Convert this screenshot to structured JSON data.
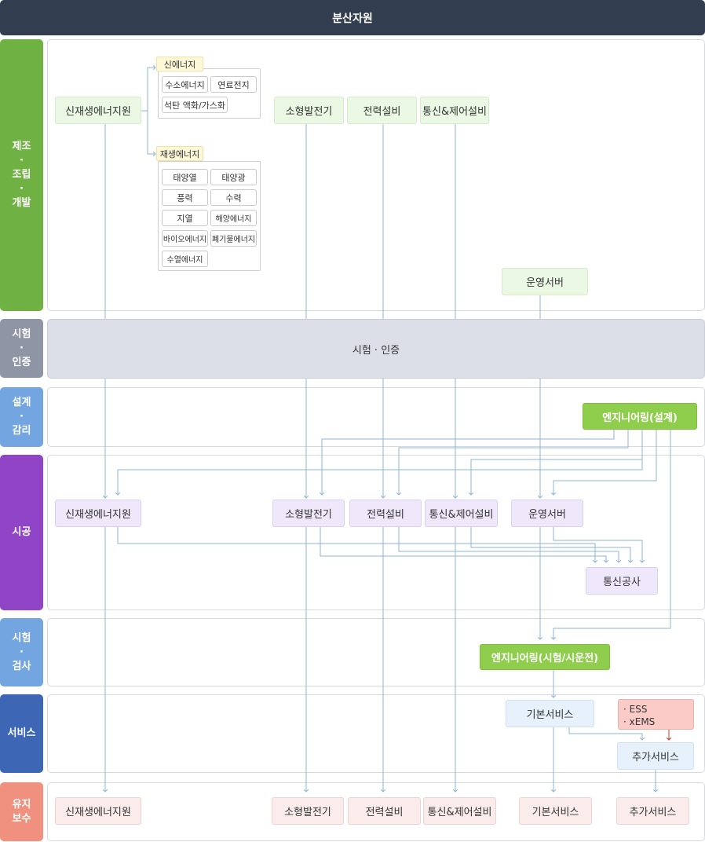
{
  "title": "분산자원",
  "stages": {
    "manufacture": "제조\n·\n조립\n·\n개발",
    "test_cert": "시험\n·\n인증",
    "design": "설계\n·\n감리",
    "construction": "시공",
    "inspection": "시험\n·\n검사",
    "service": "서비스",
    "maintenance": "유지\n보수"
  },
  "manufacture": {
    "renewable": "신재생에너지원",
    "new_energy": {
      "label": "신에너지",
      "items": [
        "수소에너지",
        "연료전지",
        "석탄 액화/가스화"
      ]
    },
    "renewable_energy": {
      "label": "재생에너지",
      "items": [
        "태양열",
        "태양광",
        "풍력",
        "수력",
        "지열",
        "해양에너지",
        "바이오에너지",
        "폐기물에너지",
        "수열에너지"
      ]
    },
    "small_gen": "소형발전기",
    "power_equip": "전력설비",
    "comm_control": "통신&제어설비",
    "ops_server": "운영서버"
  },
  "test_cert_band": "시험 · 인증",
  "design": {
    "engineering": "엔지니어링(설계)"
  },
  "construction": {
    "renewable": "신재생에너지원",
    "small_gen": "소형발전기",
    "power_equip": "전력설비",
    "comm_control": "통신&제어설비",
    "ops_server": "운영서버",
    "telecom": "통신공사"
  },
  "inspection": {
    "engineering": "엔지니어링(시험/시운전)"
  },
  "service": {
    "basic": "기본서비스",
    "extra_items": [
      "· ESS",
      "· xEMS"
    ],
    "additional": "추가서비스"
  },
  "maintenance": {
    "renewable": "신재생에너지원",
    "small_gen": "소형발전기",
    "power_equip": "전력설비",
    "comm_control": "통신&제어설비",
    "basic": "기본서비스",
    "additional": "추가서비스"
  },
  "colors": {
    "topbar": "#323e4f",
    "manufacture": "#6fb142",
    "test_cert": "#8f95a5",
    "design": "#73a6e0",
    "construction": "#8f45c6",
    "inspection": "#73a6e0",
    "service": "#3d67b5",
    "maintenance": "#f0917f",
    "line": "#8fb5d6",
    "line_red": "#c0392b"
  }
}
